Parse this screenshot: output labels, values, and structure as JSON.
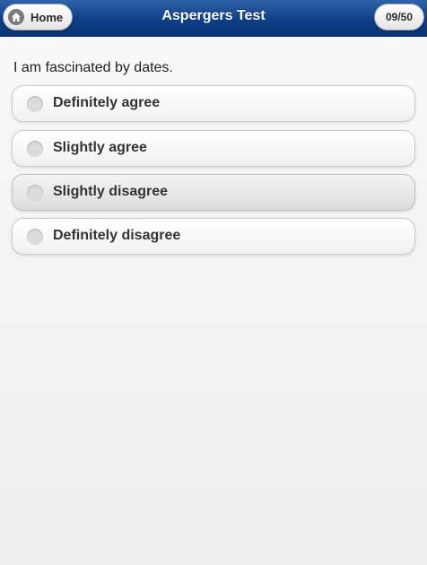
{
  "header": {
    "title": "Aspergers Test",
    "home_label": "Home",
    "home_icon": "home-icon",
    "counter": "09/50",
    "colors": {
      "bar": "#0f3f86",
      "title": "#ffffff"
    }
  },
  "question": {
    "text": "I am fascinated by dates."
  },
  "options": [
    {
      "label": "Definitely agree",
      "selected": false
    },
    {
      "label": "Slightly agree",
      "selected": false
    },
    {
      "label": "Slightly disagree",
      "selected": false,
      "highlighted": true
    },
    {
      "label": "Definitely disagree",
      "selected": false
    }
  ]
}
